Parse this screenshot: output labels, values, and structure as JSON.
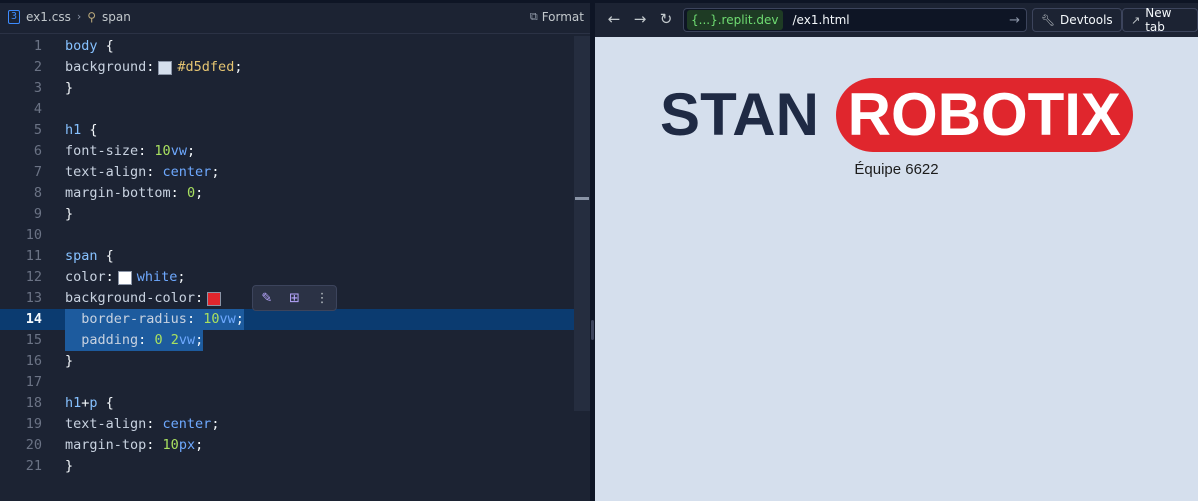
{
  "editor": {
    "file_name": "ex1.css",
    "breadcrumb_symbol": "span",
    "format_label": "Format",
    "lines": [
      {
        "n": "1"
      },
      {
        "n": "2"
      },
      {
        "n": "3"
      },
      {
        "n": "4"
      },
      {
        "n": "5"
      },
      {
        "n": "6"
      },
      {
        "n": "7"
      },
      {
        "n": "8"
      },
      {
        "n": "9"
      },
      {
        "n": "10"
      },
      {
        "n": "11"
      },
      {
        "n": "12"
      },
      {
        "n": "13"
      },
      {
        "n": "14"
      },
      {
        "n": "15"
      },
      {
        "n": "16"
      },
      {
        "n": "17"
      },
      {
        "n": "18"
      },
      {
        "n": "19"
      },
      {
        "n": "20"
      },
      {
        "n": "21"
      }
    ],
    "code": {
      "l1_sel": "body",
      "l1_brace": " {",
      "l2_prop": "background",
      "l2_val": "#d5dfed",
      "l3": "}",
      "l5_sel": "h1",
      "l5_brace": " {",
      "l6_prop": "font-size",
      "l6_num": "10",
      "l6_unit": "vw",
      "l7_prop": "text-align",
      "l7_val": "center",
      "l8_prop": "margin-bottom",
      "l8_num": "0",
      "l9": "}",
      "l11_sel": "span",
      "l11_brace": " {",
      "l12_prop": "color",
      "l12_val": "white",
      "l13_prop": "background-color",
      "l14_prop": "border-radius",
      "l14_num": "10",
      "l14_unit": "vw",
      "l15_prop": "padding",
      "l15_num1": "0",
      "l15_num2": "2",
      "l15_unit": "vw",
      "l16": "}",
      "l18_sel1": "h1",
      "l18_plus": "+",
      "l18_sel2": "p",
      "l18_brace": " {",
      "l19_prop": "text-align",
      "l19_val": "center",
      "l20_prop": "margin-top",
      "l20_num": "10",
      "l20_unit": "px",
      "l21": "}"
    },
    "swatches": {
      "background": "#d5dfed",
      "color": "#ffffff",
      "background_color": "#e0262d"
    },
    "inline_toolbar": {
      "icons": [
        "edit-with-ai-icon",
        "add-to-chat-icon",
        "more-options-icon"
      ]
    }
  },
  "browser": {
    "url_host": ".replit.dev",
    "url_host_prefix": "{...}",
    "url_path": "/ex1.html",
    "devtools_label": "Devtools",
    "new_tab_label": "New tab"
  },
  "page": {
    "title_plain": "STAN",
    "title_badge": "ROBOTIX",
    "subtitle": "Équipe 6622"
  },
  "colors": {
    "page_background": "#d5dfed",
    "badge_red": "#e0262d",
    "title_navy": "#1f2a44",
    "editor_bg": "#1c2333"
  }
}
